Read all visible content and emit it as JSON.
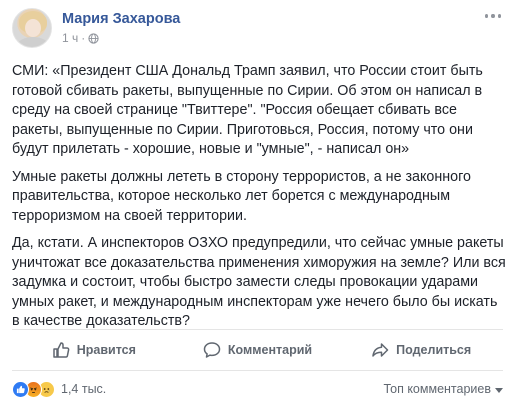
{
  "post": {
    "author": "Мария Захарова",
    "time": "1 ч",
    "separator": "·",
    "icons": {
      "audience": "globe-icon",
      "more": "more-options-icon"
    },
    "paragraphs": [
      "СМИ: «Президент США Дональд Трамп заявил, что России стоит быть готовой сбивать ракеты, выпущенные по Сирии. Об этом он написал в среду на своей странице \"Твиттере\". \"Россия обещает сбивать все ракеты, выпущенные по Сирии. Приготовься, Россия, потому что они будут прилетать - хорошие, новые и \"умные\", - написал он»",
      "Умные ракеты должны лететь в сторону террористов, а не законного правительства, которое несколько лет борется с международным терроризмом на своей территории.",
      "Да, кстати. А инспекторов ОЗХО предупредили, что сейчас умные ракеты уничтожат все доказательства применения химоружия на земле? Или вся задумка и состоит, чтобы быстро замести следы провокации ударами умных ракет, и международным инспекторам уже нечего было бы искать в качестве доказательств?"
    ]
  },
  "actions": {
    "like": {
      "label": "Нравится",
      "icon": "thumbs-up-icon"
    },
    "comment": {
      "label": "Комментарий",
      "icon": "comment-icon"
    },
    "share": {
      "label": "Поделиться",
      "icon": "share-icon"
    }
  },
  "footer": {
    "reactions": [
      "like-reaction-icon",
      "angry-reaction-icon",
      "sad-reaction-icon"
    ],
    "reaction_count": "1,4 тыс.",
    "sort_label": "Топ комментариев"
  },
  "colors": {
    "author_link": "#365899",
    "secondary_text": "#90949c",
    "action_text": "#606770",
    "like_blue": "#2f7bf3"
  }
}
